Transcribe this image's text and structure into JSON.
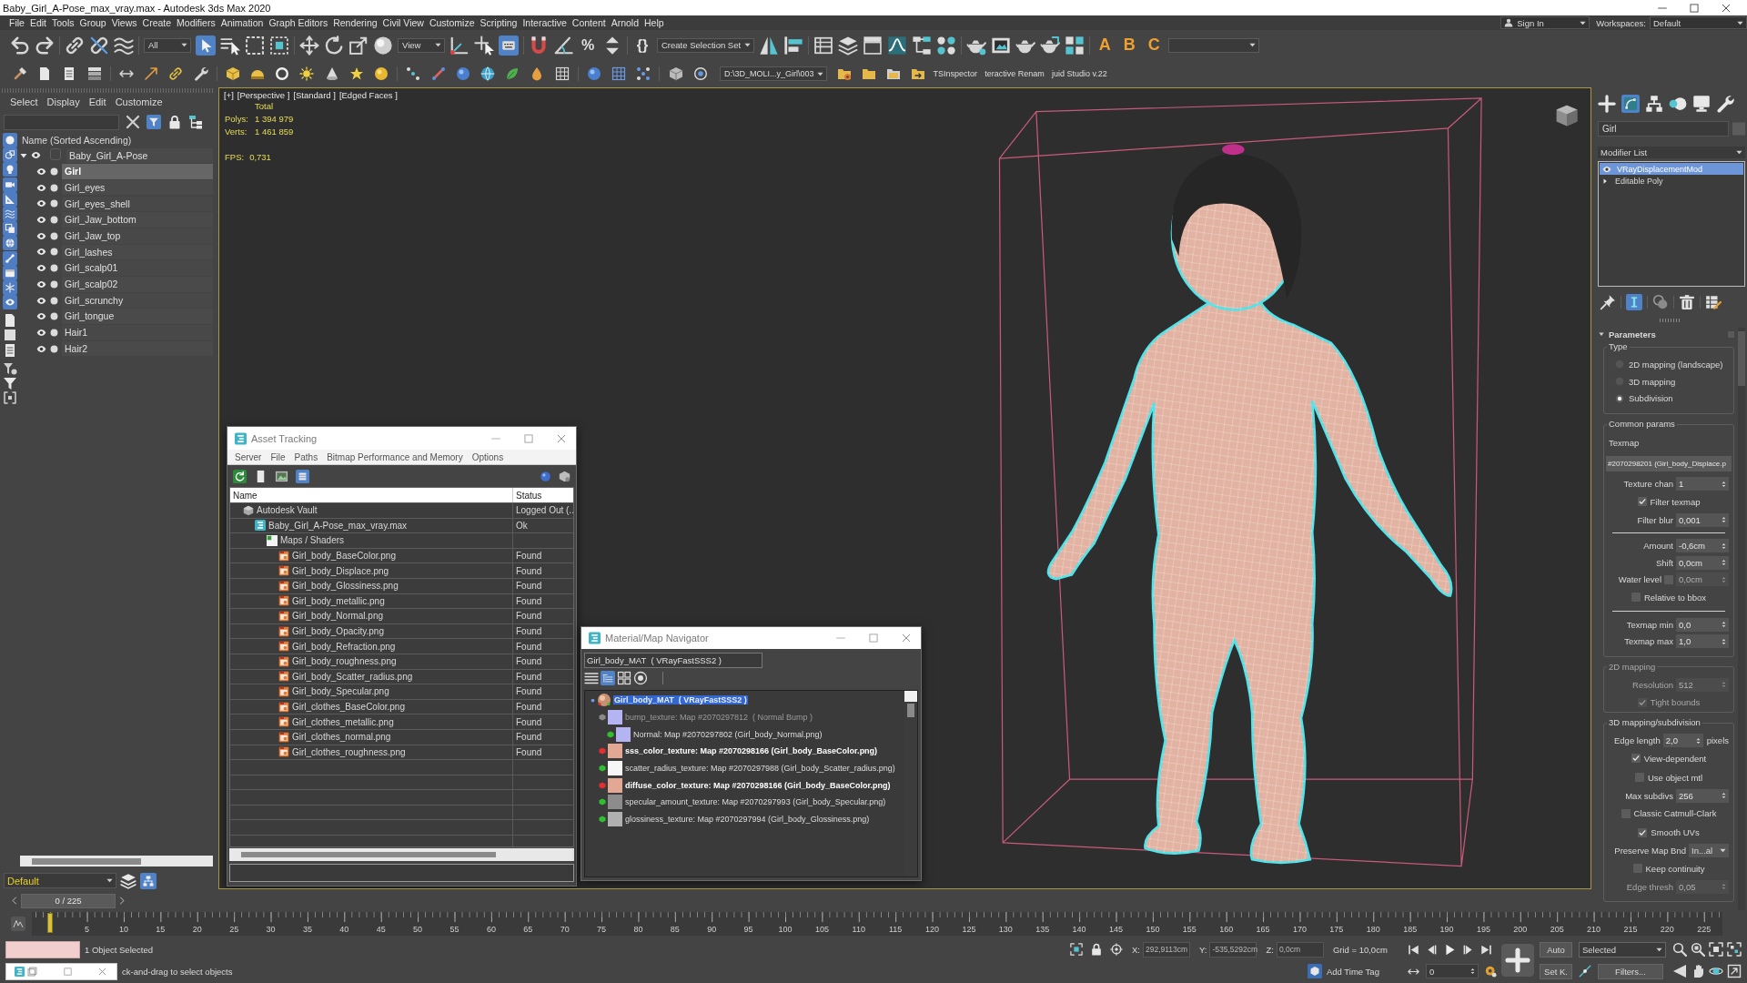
{
  "window": {
    "title": "Baby_Girl_A-Pose_max_vray.max - Autodesk 3ds Max 2020"
  },
  "menu_bar": {
    "items": [
      "File",
      "Edit",
      "Tools",
      "Group",
      "Views",
      "Create",
      "Modifiers",
      "Animation",
      "Graph Editors",
      "Rendering",
      "Civil View",
      "Customize",
      "Scripting",
      "Interactive",
      "Content",
      "Arnold",
      "Help"
    ],
    "sign_in": "Sign In",
    "workspaces_label": "Workspaces:",
    "workspace": "Default"
  },
  "main_toolbar": [
    {
      "kind": "icon",
      "pressed": false
    },
    {
      "kind": "icon",
      "pressed": false
    },
    {
      "kind": "separator"
    },
    {
      "kind": "icon",
      "pressed": false
    },
    {
      "kind": "icon",
      "pressed": false
    },
    {
      "kind": "icon",
      "pressed": false
    },
    {
      "kind": "separator"
    },
    {
      "kind": "dropdown",
      "value": "All"
    },
    {
      "kind": "icon",
      "pressed": true
    },
    {
      "kind": "icon",
      "pressed": false
    },
    {
      "kind": "icon",
      "pressed": false
    },
    {
      "kind": "icon",
      "pressed": false
    },
    {
      "kind": "separator"
    },
    {
      "kind": "icon",
      "pressed": false
    },
    {
      "kind": "icon",
      "pressed": false
    },
    {
      "kind": "icon",
      "pressed": false
    },
    {
      "kind": "icon",
      "pressed": false
    },
    {
      "kind": "dropdown",
      "value": "View"
    },
    {
      "kind": "icon",
      "pressed": false
    },
    {
      "kind": "icon",
      "pressed": false
    },
    {
      "kind": "icon",
      "pressed": true
    },
    {
      "kind": "separator"
    },
    {
      "kind": "icon",
      "pressed": false
    },
    {
      "kind": "icon",
      "pressed": false
    },
    {
      "kind": "glyph",
      "text": "%"
    },
    {
      "kind": "icon",
      "pressed": false
    },
    {
      "kind": "separator"
    },
    {
      "kind": "glyph",
      "text": "{}"
    },
    {
      "kind": "dropdown",
      "value": "Create Selection Set"
    },
    {
      "kind": "icon",
      "pressed": false
    },
    {
      "kind": "icon",
      "pressed": false
    },
    {
      "kind": "separator"
    },
    {
      "kind": "icon",
      "pressed": false
    },
    {
      "kind": "icon",
      "pressed": false
    },
    {
      "kind": "icon",
      "pressed": false
    },
    {
      "kind": "icon",
      "pressed": false
    },
    {
      "kind": "icon",
      "pressed": false
    },
    {
      "kind": "icon",
      "pressed": false
    },
    {
      "kind": "separator"
    },
    {
      "kind": "icon",
      "pressed": false
    },
    {
      "kind": "icon",
      "pressed": false
    },
    {
      "kind": "icon",
      "pressed": false
    },
    {
      "kind": "icon",
      "pressed": false
    },
    {
      "kind": "icon",
      "pressed": false
    },
    {
      "kind": "separator"
    },
    {
      "kind": "script",
      "text": "A"
    },
    {
      "kind": "script",
      "text": "B"
    },
    {
      "kind": "script",
      "text": "C"
    },
    {
      "kind": "dropdown"
    }
  ],
  "secondary_toolbar": [
    {
      "kind": "icon"
    },
    {
      "kind": "icon"
    },
    {
      "kind": "icon"
    },
    {
      "kind": "icon"
    },
    {
      "kind": "separator"
    },
    {
      "kind": "icon"
    },
    {
      "kind": "icon"
    },
    {
      "kind": "icon"
    },
    {
      "kind": "icon"
    },
    {
      "kind": "separator"
    },
    {
      "kind": "icon"
    },
    {
      "kind": "icon"
    },
    {
      "kind": "icon"
    },
    {
      "kind": "icon"
    },
    {
      "kind": "icon"
    },
    {
      "kind": "icon"
    },
    {
      "kind": "icon"
    },
    {
      "kind": "separator"
    },
    {
      "kind": "icon"
    },
    {
      "kind": "icon"
    },
    {
      "kind": "icon"
    },
    {
      "kind": "icon"
    },
    {
      "kind": "icon"
    },
    {
      "kind": "icon"
    },
    {
      "kind": "icon"
    },
    {
      "kind": "separator"
    },
    {
      "kind": "icon"
    },
    {
      "kind": "icon"
    },
    {
      "kind": "icon"
    },
    {
      "kind": "separator"
    },
    {
      "kind": "icon"
    },
    {
      "kind": "icon"
    },
    {
      "kind": "dropdown",
      "value": "D:\\3D_MOLI...y_Girl\\003"
    },
    {
      "kind": "icon"
    },
    {
      "kind": "icon"
    },
    {
      "kind": "icon"
    },
    {
      "kind": "icon"
    },
    {
      "kind": "label",
      "text": "TSInspector"
    },
    {
      "kind": "label",
      "text": "teractive Renam"
    },
    {
      "kind": "label",
      "text": "juid Studio v.22"
    }
  ],
  "scene_explorer": {
    "menus": [
      "Select",
      "Display",
      "Edit",
      "Customize"
    ],
    "tools": [
      {
        "pressed": false
      },
      {
        "pressed": true
      },
      {
        "pressed": false
      },
      {
        "pressed": false
      }
    ],
    "filters": [
      {
        "pressed": true
      },
      {
        "pressed": true
      },
      {
        "pressed": true
      },
      {
        "pressed": true
      },
      {
        "pressed": true
      },
      {
        "pressed": true
      },
      {
        "pressed": true
      },
      {
        "pressed": true
      },
      {
        "pressed": true
      },
      {
        "pressed": true
      },
      {
        "pressed": true
      },
      {
        "pressed": true
      },
      {
        "pressed": false
      },
      {
        "pressed": false
      },
      {
        "pressed": false
      },
      {
        "pressed": false
      },
      {
        "pressed": false
      },
      {
        "pressed": false
      }
    ],
    "column": "Name (Sorted Ascending)",
    "tree": [
      {
        "name": "Baby_Girl_A-Pose",
        "expanded": true,
        "selected": false,
        "children": [
          {
            "name": "Girl",
            "selected": true
          },
          {
            "name": "Girl_eyes",
            "selected": false
          },
          {
            "name": "Girl_eyes_shell",
            "selected": false
          },
          {
            "name": "Girl_Jaw_bottom",
            "selected": false
          },
          {
            "name": "Girl_Jaw_top",
            "selected": false
          },
          {
            "name": "Girl_lashes",
            "selected": false
          },
          {
            "name": "Girl_scalp01",
            "selected": false
          },
          {
            "name": "Girl_scalp02",
            "selected": false
          },
          {
            "name": "Girl_scrunchy",
            "selected": false
          },
          {
            "name": "Girl_tongue",
            "selected": false
          },
          {
            "name": "Hair1",
            "selected": false
          },
          {
            "name": "Hair2",
            "selected": false
          }
        ]
      }
    ],
    "layer": "Default",
    "layer_tools": [
      {
        "pressed": false
      },
      {
        "pressed": true
      }
    ],
    "frame_counter": "0 / 225"
  },
  "viewport": {
    "active": true,
    "labels": [
      "[+]",
      "[Perspective ]",
      "[Standard ]",
      "[Edged Faces ]"
    ],
    "stats_heading": "Total",
    "stats": [
      {
        "label": "Polys:",
        "value": "1 394 979"
      },
      {
        "label": "Verts:",
        "value": "1 461 859"
      }
    ],
    "fps": {
      "label": "FPS:",
      "value": "0,731"
    }
  },
  "asset_tracking": {
    "title": "Asset Tracking",
    "menus": [
      "Server",
      "File",
      "Paths",
      "Bitmap Performance and Memory",
      "Options"
    ],
    "toolbar": [
      {
        "pressed": false
      },
      {
        "pressed": false
      },
      {
        "pressed": false
      },
      {
        "pressed": true
      }
    ],
    "columns": [
      "Name",
      "Status"
    ],
    "tree": [
      {
        "kind": "vault",
        "name": "Autodesk Vault",
        "status": "Logged Out (..",
        "children": [
          {
            "kind": "scene",
            "name": "Baby_Girl_A-Pose_max_vray.max",
            "status": "Ok",
            "children": [
              {
                "kind": "folder",
                "name": "Maps / Shaders",
                "children": [
                  {
                    "kind": "bitmap",
                    "name": "Girl_body_BaseColor.png",
                    "status": "Found"
                  },
                  {
                    "kind": "bitmap",
                    "name": "Girl_body_Displace.png",
                    "status": "Found"
                  },
                  {
                    "kind": "bitmap",
                    "name": "Girl_body_Glossiness.png",
                    "status": "Found"
                  },
                  {
                    "kind": "bitmap",
                    "name": "Girl_body_metallic.png",
                    "status": "Found"
                  },
                  {
                    "kind": "bitmap",
                    "name": "Girl_body_Normal.png",
                    "status": "Found"
                  },
                  {
                    "kind": "bitmap",
                    "name": "Girl_body_Opacity.png",
                    "status": "Found"
                  },
                  {
                    "kind": "bitmap",
                    "name": "Girl_body_Refraction.png",
                    "status": "Found"
                  },
                  {
                    "kind": "bitmap",
                    "name": "Girl_body_roughness.png",
                    "status": "Found"
                  },
                  {
                    "kind": "bitmap",
                    "name": "Girl_body_Scatter_radius.png",
                    "status": "Found"
                  },
                  {
                    "kind": "bitmap",
                    "name": "Girl_body_Specular.png",
                    "status": "Found"
                  },
                  {
                    "kind": "bitmap",
                    "name": "Girl_clothes_BaseColor.png",
                    "status": "Found"
                  },
                  {
                    "kind": "bitmap",
                    "name": "Girl_clothes_metallic.png",
                    "status": "Found"
                  },
                  {
                    "kind": "bitmap",
                    "name": "Girl_clothes_normal.png",
                    "status": "Found"
                  },
                  {
                    "kind": "bitmap",
                    "name": "Girl_clothes_roughness.png",
                    "status": "Found"
                  }
                ]
              }
            ]
          }
        ]
      }
    ]
  },
  "material_navigator": {
    "title": "Material/Map Navigator",
    "name_field": "Girl_body_MAT  ( VRayFastSSS2 )",
    "view_modes": [
      {
        "selected": false
      },
      {
        "selected": true
      },
      {
        "selected": false
      },
      {
        "selected": false
      }
    ],
    "tree": [
      {
        "label": "Girl_body_MAT  ( VRayFastSSS2 )",
        "selected": true,
        "children": [
          {
            "label": "bump_texture: Map #2070297812  ( Normal Bump )",
            "selected": false,
            "disabled": true,
            "active": false,
            "color": "#b4b4f2",
            "children": [
              {
                "label": "Normal: Map #2070297802 (Girl_body_Normal.png)",
                "selected": false,
                "disabled": false,
                "active": false,
                "color": "#b4b4f2"
              }
            ]
          },
          {
            "label": "sss_color_texture: Map #2070298166 (Girl_body_BaseColor.png)",
            "selected": false,
            "disabled": false,
            "active": true,
            "color": "#e2a894"
          },
          {
            "label": "scatter_radius_texture: Map #2070297988 (Girl_body_Scatter_radius.png)",
            "selected": false,
            "disabled": false,
            "active": false,
            "color": "#f6f6f6"
          },
          {
            "label": "diffuse_color_texture: Map #2070298166 (Girl_body_BaseColor.png)",
            "selected": false,
            "disabled": false,
            "active": true,
            "color": "#e2a894"
          },
          {
            "label": "specular_amount_texture: Map #2070297993 (Girl_body_Specular.png)",
            "selected": false,
            "disabled": false,
            "active": false,
            "color": "#8c8c8c"
          },
          {
            "label": "glossiness_texture: Map #2070297994 (Girl_body_Glossiness.png)",
            "selected": false,
            "disabled": false,
            "active": false,
            "color": "#b0b0b0"
          }
        ]
      }
    ]
  },
  "command_panel": {
    "tabs": [
      {
        "selected": false
      },
      {
        "selected": true
      },
      {
        "selected": false
      },
      {
        "selected": false
      },
      {
        "selected": false
      },
      {
        "selected": false
      }
    ],
    "object_name": "Girl",
    "modifier_list": "Modifier List",
    "stack": [
      {
        "name": "VRayDisplacementMod",
        "kind": "modifier",
        "selected": true
      },
      {
        "name": "Editable Poly",
        "kind": "base",
        "selected": false
      }
    ],
    "stack_tools": [
      {
        "pressed": false
      },
      {
        "pressed": true
      },
      {
        "pressed": false
      },
      {
        "pressed": false
      },
      {
        "pressed": false
      }
    ],
    "rollout": {
      "title": "Parameters",
      "expanded": true,
      "groups": [
        {
          "title": "Type",
          "disabled": false,
          "rows": [
            {
              "kind": "radio",
              "label": "2D mapping (landscape)",
              "selected": false,
              "disabled": false
            },
            {
              "kind": "radio",
              "label": "3D mapping",
              "selected": false,
              "disabled": false
            },
            {
              "kind": "radio",
              "label": "Subdivision",
              "selected": true,
              "disabled": false
            }
          ]
        },
        {
          "title": "Common params",
          "disabled": false,
          "rows": [
            {
              "kind": "label",
              "label": "Texmap"
            },
            {
              "kind": "map",
              "value": "#2070298201 (Girl_body_Displace.p",
              "disabled": false
            },
            {
              "kind": "spinner",
              "label": "Texture chan",
              "value": "1",
              "disabled": false
            },
            {
              "kind": "checkbox",
              "label": "Filter texmap",
              "checked": true,
              "disabled": false
            },
            {
              "kind": "spinner",
              "label": "Filter blur",
              "value": "0,001",
              "disabled": false
            },
            {
              "kind": "rule"
            },
            {
              "kind": "spinner",
              "label": "Amount",
              "value": "-0,6cm",
              "disabled": false
            },
            {
              "kind": "spinner",
              "label": "Shift",
              "value": "0,0cm",
              "disabled": false
            },
            {
              "kind": "check_spinner",
              "label": "Water level",
              "checked": false,
              "value": "0,0cm"
            },
            {
              "kind": "checkbox",
              "label": "Relative to bbox",
              "checked": false,
              "disabled": false
            },
            {
              "kind": "rule"
            },
            {
              "kind": "spinner",
              "label": "Texmap min",
              "value": "0,0",
              "disabled": false
            },
            {
              "kind": "spinner",
              "label": "Texmap max",
              "value": "1,0",
              "disabled": false
            }
          ]
        },
        {
          "title": "2D mapping",
          "disabled": true,
          "rows": [
            {
              "kind": "spinner",
              "label": "Resolution",
              "value": "512",
              "disabled": true
            },
            {
              "kind": "checkbox",
              "label": "Tight bounds",
              "checked": true,
              "disabled": true
            }
          ]
        },
        {
          "title": "3D mapping/subdivision",
          "disabled": false,
          "rows": [
            {
              "kind": "spinner",
              "label": "Edge length",
              "value": "2,0",
              "unit": "pixels",
              "disabled": false
            },
            {
              "kind": "checkbox",
              "label": "View-dependent",
              "checked": true,
              "disabled": false
            },
            {
              "kind": "checkbox",
              "label": "Use object mtl",
              "checked": false,
              "disabled": false
            },
            {
              "kind": "spinner",
              "label": "Max subdivs",
              "value": "256",
              "disabled": false
            },
            {
              "kind": "checkbox",
              "label": "Classic Catmull-Clark",
              "checked": false,
              "disabled": false
            },
            {
              "kind": "checkbox",
              "label": "Smooth UVs",
              "checked": true,
              "disabled": false
            },
            {
              "kind": "dropdown",
              "label": "Preserve Map Bnd",
              "value": "In...al",
              "disabled": false
            },
            {
              "kind": "checkbox",
              "label": "Keep continuity",
              "checked": false,
              "disabled": false
            },
            {
              "kind": "spinner",
              "label": "Edge thresh",
              "value": "0,05",
              "disabled": true
            }
          ]
        }
      ]
    }
  },
  "timeline": {
    "level": 0,
    "ticks": [
      "5",
      "10",
      "15",
      "20",
      "25",
      "30",
      "35",
      "40",
      "45",
      "50",
      "55",
      "60",
      "65",
      "70",
      "75",
      "80",
      "85",
      "90",
      "95",
      "100",
      "105",
      "110",
      "115",
      "120",
      "125",
      "130",
      "135",
      "140",
      "145",
      "150",
      "155",
      "160",
      "165",
      "170",
      "175",
      "180",
      "185",
      "190",
      "195",
      "200",
      "205",
      "210",
      "215",
      "220",
      "225"
    ]
  },
  "status_bar": {
    "selection_info": "1 Object Selected",
    "prompt": "ck-and-drag to select objects",
    "coords": [
      {
        "label": "X:",
        "value": "292,9113cm"
      },
      {
        "label": "Y:",
        "value": "-535,5292cm"
      },
      {
        "label": "Z:",
        "value": "0,0cm"
      }
    ],
    "grid": "Grid = 10,0cm",
    "time_tag": "Add Time Tag",
    "frame": "0",
    "auto_key": "Auto",
    "key_mode": "Selected",
    "set_key": "Set K.",
    "filters": "Filters..."
  }
}
